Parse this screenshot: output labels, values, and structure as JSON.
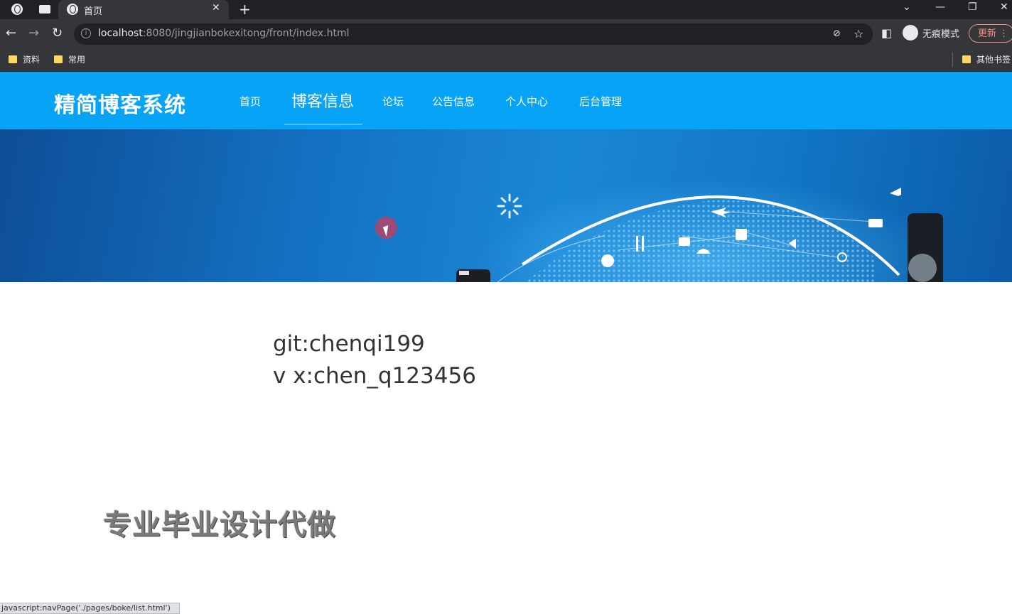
{
  "browser": {
    "tab_title": "首页",
    "url_host": "localhost",
    "url_rest": ":8080/jingjianbokexitong/front/index.html",
    "incognito_label": "无痕模式",
    "update_label": "更新",
    "bookmarks": [
      "资料",
      "常用"
    ],
    "other_bookmarks": "其他书签",
    "status_text": "javascript:navPage('./pages/boke/list.html')"
  },
  "site": {
    "logo": "精简博客系统",
    "nav": [
      "首页",
      "博客信息",
      "论坛",
      "公告信息",
      "个人中心",
      "后台管理"
    ],
    "active_nav": "博客信息",
    "accent": "#06a3f6"
  },
  "content": {
    "contact_line1": "git:chenqi199",
    "contact_line2": "v x:chen_q123456",
    "promo": "专业毕业设计代做"
  }
}
